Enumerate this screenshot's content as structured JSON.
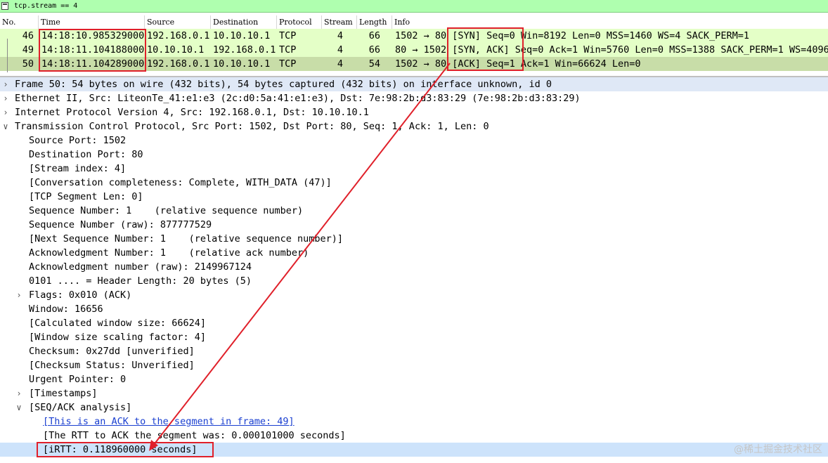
{
  "filter": {
    "value": "tcp.stream == 4"
  },
  "packet_list": {
    "columns": [
      "No.",
      "Time",
      "Source",
      "Destination",
      "Protocol",
      "Stream",
      "Length",
      "Info"
    ],
    "rows": [
      {
        "no": "46",
        "time": "14:18:10.985329000",
        "source": "192.168.0.1",
        "destination": "10.10.10.1",
        "protocol": "TCP",
        "stream": "4",
        "length": "66",
        "info_ports": "1502 → 80",
        "info_flags": "[SYN]",
        "info_rest": "Seq=0 Win=8192 Len=0 MSS=1460 WS=4 SACK_PERM=1"
      },
      {
        "no": "49",
        "time": "14:18:11.104188000",
        "source": "10.10.10.1",
        "destination": "192.168.0.1",
        "protocol": "TCP",
        "stream": "4",
        "length": "66",
        "info_ports": "80 → 1502",
        "info_flags": "[SYN, ACK]",
        "info_rest": "Seq=0 Ack=1 Win=5760 Len=0 MSS=1388 SACK_PERM=1 WS=4096"
      },
      {
        "no": "50",
        "time": "14:18:11.104289000",
        "source": "192.168.0.1",
        "destination": "10.10.10.1",
        "protocol": "TCP",
        "stream": "4",
        "length": "54",
        "info_ports": "1502 → 80",
        "info_flags": "[ACK]",
        "info_rest": "Seq=1 Ack=1 Win=66624 Len=0"
      }
    ]
  },
  "details": {
    "top": [
      "Frame 50: 54 bytes on wire (432 bits), 54 bytes captured (432 bits) on interface unknown, id 0",
      "Ethernet II, Src: LiteonTe_41:e1:e3 (2c:d0:5a:41:e1:e3), Dst: 7e:98:2b:d3:83:29 (7e:98:2b:d3:83:29)",
      "Internet Protocol Version 4, Src: 192.168.0.1, Dst: 10.10.10.1",
      "Transmission Control Protocol, Src Port: 1502, Dst Port: 80, Seq: 1, Ack: 1, Len: 0"
    ],
    "tcp": [
      "Source Port: 1502",
      "Destination Port: 80",
      "[Stream index: 4]",
      "[Conversation completeness: Complete, WITH_DATA (47)]",
      "[TCP Segment Len: 0]",
      "Sequence Number: 1    (relative sequence number)",
      "Sequence Number (raw): 877777529",
      "[Next Sequence Number: 1    (relative sequence number)]",
      "Acknowledgment Number: 1    (relative ack number)",
      "Acknowledgment number (raw): 2149967124",
      "0101 .... = Header Length: 20 bytes (5)",
      "Flags: 0x010 (ACK)",
      "Window: 16656",
      "[Calculated window size: 66624]",
      "[Window size scaling factor: 4]",
      "Checksum: 0x27dd [unverified]",
      "[Checksum Status: Unverified]",
      "Urgent Pointer: 0",
      "[Timestamps]",
      "[SEQ/ACK analysis]"
    ],
    "seqack": [
      "[This is an ACK to the segment in frame: 49]",
      "[The RTT to ACK the segment was: 0.000101000 seconds]",
      "[iRTT: 0.118960000 seconds]"
    ]
  },
  "watermark": "@稀土掘金技术社区",
  "colors": {
    "annotation": "#e0202a",
    "row_green": "#e4ffc7",
    "row_selected": "#c8dda8",
    "filter_ok": "#afffaf"
  }
}
